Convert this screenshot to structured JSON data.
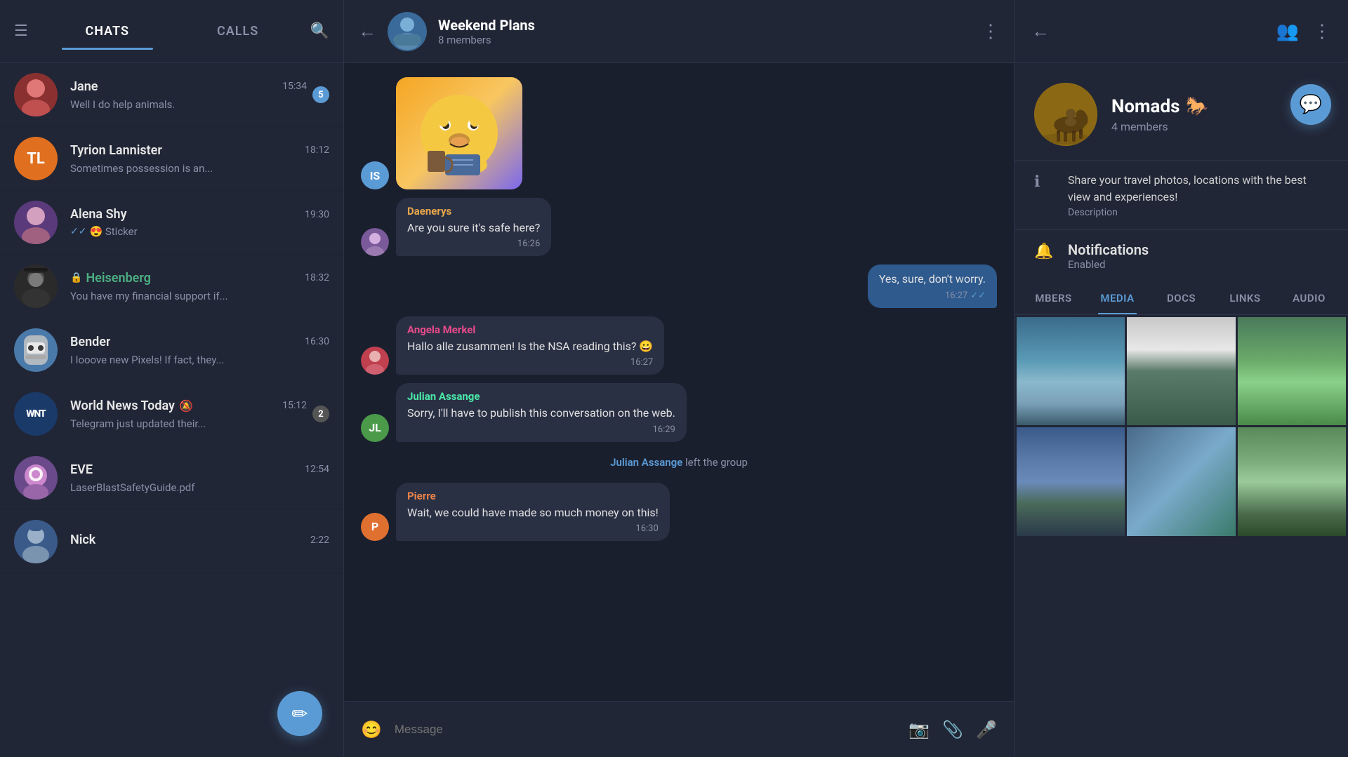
{
  "app": {
    "title": "Telegram"
  },
  "left_panel": {
    "tabs": [
      {
        "id": "chats",
        "label": "CHATS",
        "active": true
      },
      {
        "id": "calls",
        "label": "CALLS",
        "active": false
      }
    ],
    "fab_icon": "✏",
    "chats": [
      {
        "id": "jane",
        "name": "Jane",
        "preview": "Well I do help animals.",
        "time": "15:34",
        "badge": "5",
        "avatar_type": "image",
        "avatar_color": "#c0392b"
      },
      {
        "id": "tyrion",
        "name": "Tyrion Lannister",
        "preview": "Sometimes possession is an...",
        "time": "18:12",
        "initials": "TL",
        "avatar_color": "#e07020"
      },
      {
        "id": "alena",
        "name": "Alena Shy",
        "preview": "😍 Sticker",
        "time": "19:30",
        "double_check": true,
        "avatar_type": "image"
      },
      {
        "id": "heisenberg",
        "name": "Heisenberg",
        "preview": "You have my financial support if...",
        "time": "18:32",
        "lock": true,
        "name_green": true,
        "avatar_type": "image"
      },
      {
        "id": "bender",
        "name": "Bender",
        "preview": "I looove new Pixels! If fact, they...",
        "time": "16:30",
        "avatar_type": "image"
      },
      {
        "id": "worldnews",
        "name": "World News Today",
        "name_suffix": "🔕",
        "preview": "Telegram just updated their...",
        "time": "15:12",
        "badge": "2",
        "badge_gray": true,
        "avatar_type": "wnt"
      },
      {
        "id": "eve",
        "name": "EVE",
        "preview": "LaserBlastSafetyGuide.pdf",
        "time": "12:54",
        "avatar_type": "image"
      },
      {
        "id": "nick",
        "name": "Nick",
        "preview": "",
        "time": "2:22",
        "avatar_type": "image"
      }
    ]
  },
  "middle_panel": {
    "group_name": "Weekend Plans",
    "member_count": "8 members",
    "messages": [
      {
        "id": "sticker",
        "type": "sticker",
        "sender_avatar": "IS",
        "avatar_color": "#5b9bd5"
      },
      {
        "id": "msg1",
        "type": "received",
        "sender": "Daenerys",
        "sender_color": "#e8a84a",
        "text": "Are you sure it's safe here?",
        "time": "16:26",
        "avatar_type": "image"
      },
      {
        "id": "msg2",
        "type": "sent",
        "text": "Yes, sure, don't worry.",
        "time": "16:27",
        "double_check": true,
        "check_blue": true
      },
      {
        "id": "msg3",
        "type": "received",
        "sender": "Angela Merkel",
        "sender_color": "#e84a8a",
        "text": "Hallo alle zusammen! Is the NSA reading this? 😀",
        "time": "16:27",
        "avatar_type": "image"
      },
      {
        "id": "msg4",
        "type": "received",
        "sender": "Julian Assange",
        "sender_color": "#4ae8a8",
        "text": "Sorry, I'll have to publish this conversation on the web.",
        "time": "16:29",
        "initials": "JL",
        "avatar_color": "#4a9a4a"
      },
      {
        "id": "system1",
        "type": "system",
        "text": "Julian Assange left the group",
        "name": "Julian Assange"
      },
      {
        "id": "msg5",
        "type": "received",
        "sender": "Pierre",
        "sender_color": "#e8844a",
        "text": "Wait, we could have made so much money on this!",
        "time": "16:30",
        "initials": "P",
        "avatar_color": "#e07030"
      }
    ],
    "input_placeholder": "Message",
    "more_icon": "⋮"
  },
  "right_panel": {
    "group_name": "Nomads",
    "group_emoji": "🐎",
    "member_count": "4 members",
    "description": "Share your travel photos, locations with the best view and experiences!",
    "description_label": "Description",
    "notifications_label": "Notifications",
    "notifications_status": "Enabled",
    "media_tabs": [
      {
        "id": "members",
        "label": "MBERS",
        "active": false
      },
      {
        "id": "media",
        "label": "MEDIA",
        "active": true
      },
      {
        "id": "docs",
        "label": "DOCS",
        "active": false
      },
      {
        "id": "links",
        "label": "LINKS",
        "active": false
      },
      {
        "id": "audio",
        "label": "AUDIO",
        "active": false
      }
    ],
    "photos": [
      {
        "id": "p1",
        "class": "photo-1"
      },
      {
        "id": "p2",
        "class": "photo-2"
      },
      {
        "id": "p3",
        "class": "photo-3"
      },
      {
        "id": "p4",
        "class": "photo-4"
      },
      {
        "id": "p5",
        "class": "photo-5"
      },
      {
        "id": "p6",
        "class": "photo-6"
      }
    ]
  }
}
